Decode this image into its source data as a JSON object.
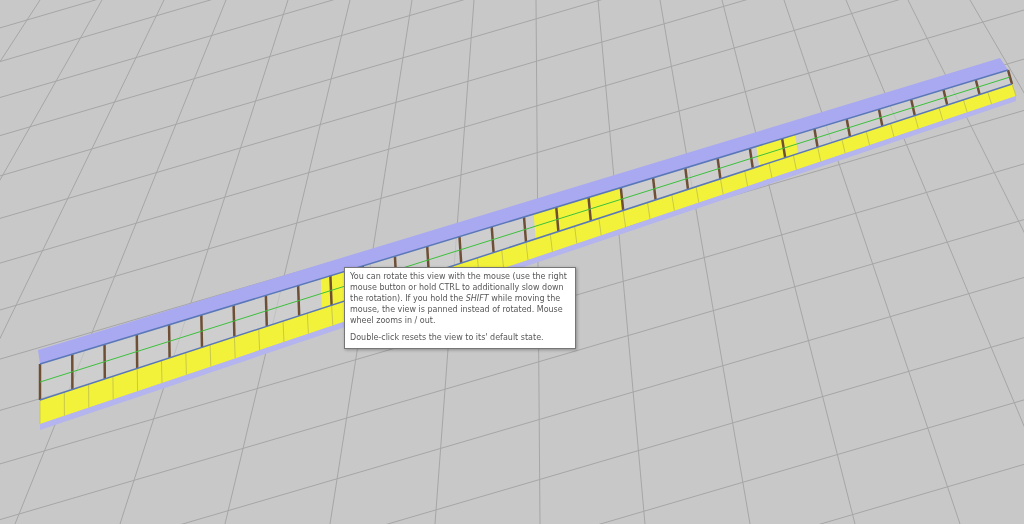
{
  "viewport": {
    "tooltip": {
      "paragraphs": [
        "You can rotate this view with the mouse (use the right mouse button or hold CTRL to additionally slow down the rotation). If you hold the *SHIFT* while moving the mouse, the view is panned instead of rotated. Mouse wheel zooms in / out.",
        "Double-click resets the view to its' default state."
      ]
    }
  }
}
